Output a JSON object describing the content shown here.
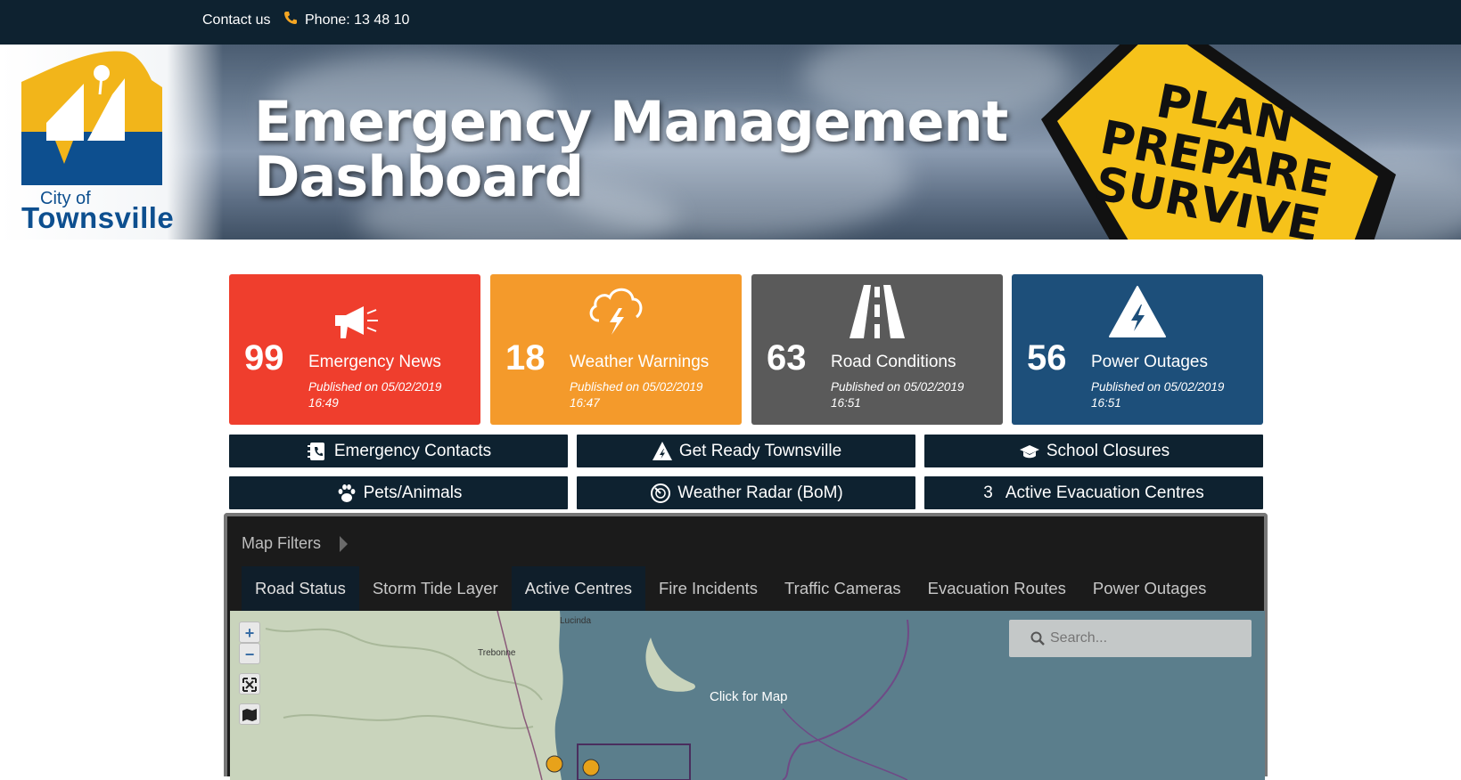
{
  "topbar": {
    "contact_label": "Contact us",
    "phone_label": "Phone: 13 48 10"
  },
  "banner": {
    "logo_city": "City of",
    "logo_town": "Townsville",
    "title_line1": "Emergency Management",
    "title_line2": "Dashboard",
    "sign_line1": "PLAN",
    "sign_line2": "PREPARE",
    "sign_line3": "SURVIVE"
  },
  "tiles": [
    {
      "count": "99",
      "label": "Emergency News",
      "published": "Published on 05/02/2019 16:49",
      "color": "#ef3e2d",
      "icon": "megaphone-icon"
    },
    {
      "count": "18",
      "label": "Weather Warnings",
      "published": "Published on 05/02/2019 16:47",
      "color": "#f49a2b",
      "icon": "storm-cloud-icon"
    },
    {
      "count": "63",
      "label": "Road Conditions",
      "published": "Published on 05/02/2019 16:51",
      "color": "#5a5a5a",
      "icon": "road-icon"
    },
    {
      "count": "56",
      "label": "Power Outages",
      "published": "Published on 05/02/2019 16:51",
      "color": "#1d4f7a",
      "icon": "power-warning-icon"
    }
  ],
  "links": {
    "emergency_contacts": "Emergency Contacts",
    "get_ready": "Get Ready Townsville",
    "school_closures": "School Closures",
    "pets_animals": "Pets/Animals",
    "weather_radar": "Weather Radar (BoM)",
    "evac_count": "3",
    "evac_label": "Active Evacuation Centres"
  },
  "map": {
    "filters_label": "Map Filters",
    "tabs": [
      "Road Status",
      "Storm Tide Layer",
      "Active Centres",
      "Fire Incidents",
      "Traffic Cameras",
      "Evacuation Routes",
      "Power Outages"
    ],
    "active_tabs": [
      "Road Status",
      "Active Centres"
    ],
    "search_placeholder": "Search...",
    "click_label": "Click for Map",
    "place_lucinda": "Lucinda",
    "place_trebonne": "Trebonne",
    "zoom_in": "+",
    "zoom_out": "−"
  },
  "colors": {
    "navy": "#0e2230",
    "accent": "#f5a623"
  }
}
